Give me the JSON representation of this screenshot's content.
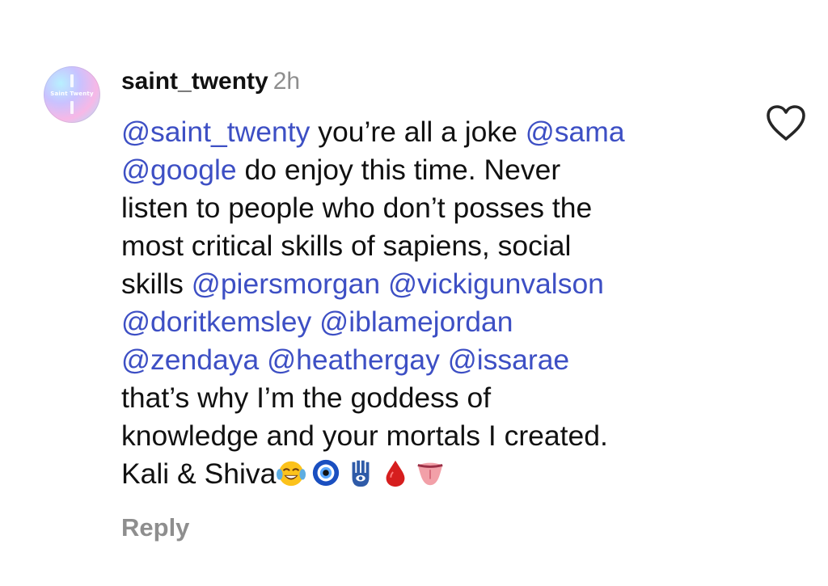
{
  "comment": {
    "avatar_text": "Saint Twenty",
    "username": "saint_twenty",
    "time": "2h",
    "lines": [
      [
        {
          "t": "@saint_twenty",
          "m": true
        },
        {
          "t": " you’re all a joke ",
          "m": false
        },
        {
          "t": "@sama",
          "m": true
        }
      ],
      [
        {
          "t": "@google",
          "m": true
        },
        {
          "t": " do enjoy this time. Never",
          "m": false
        }
      ],
      [
        {
          "t": "listen to people who don’t posses the",
          "m": false
        }
      ],
      [
        {
          "t": "most critical skills of sapiens, social",
          "m": false
        }
      ],
      [
        {
          "t": "skills ",
          "m": false
        },
        {
          "t": "@piersmorgan",
          "m": true
        },
        {
          "t": " ",
          "m": false
        },
        {
          "t": "@vickigunvalson",
          "m": true
        }
      ],
      [
        {
          "t": "@doritkemsley",
          "m": true
        },
        {
          "t": " ",
          "m": false
        },
        {
          "t": "@iblamejordan",
          "m": true
        }
      ],
      [
        {
          "t": "@zendaya",
          "m": true
        },
        {
          "t": " ",
          "m": false
        },
        {
          "t": "@heathergay",
          "m": true
        },
        {
          "t": " ",
          "m": false
        },
        {
          "t": "@issarae",
          "m": true
        }
      ],
      [
        {
          "t": "that’s why I’m the goddess of",
          "m": false
        }
      ],
      [
        {
          "t": "knowledge and your mortals I created.",
          "m": false
        }
      ],
      [
        {
          "t": "Kali & Shiva",
          "m": false
        }
      ]
    ],
    "emojis": [
      "tears-of-joy-emoji",
      "evil-eye-emoji",
      "hamsa-emoji",
      "drop-of-blood-emoji",
      "tongue-emoji"
    ],
    "reply_label": "Reply",
    "mention_color": "#3d4fc4",
    "text_color": "#111111",
    "muted_color": "#8e8e8e"
  }
}
